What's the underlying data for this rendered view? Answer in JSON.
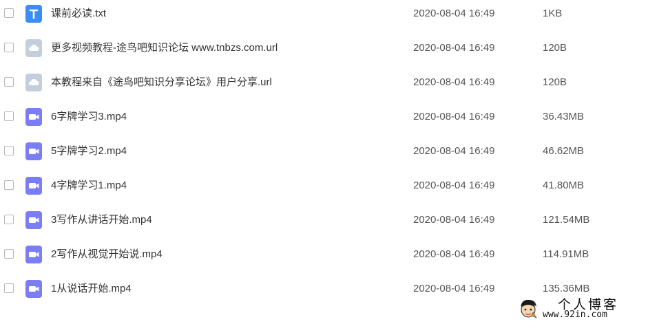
{
  "colors": {
    "txt_icon": "#3b8cf5",
    "cloud_icon": "#c3cfdc",
    "video_icon": "#7b7df5"
  },
  "files": [
    {
      "name": "课前必读.txt",
      "date": "2020-08-04 16:49",
      "size": "1KB",
      "icon": "text-file-icon"
    },
    {
      "name": "更多视频教程-途鸟吧知识论坛 www.tnbzs.com.url",
      "date": "2020-08-04 16:49",
      "size": "120B",
      "icon": "cloud-link-icon"
    },
    {
      "name": "本教程来自《途鸟吧知识分享论坛》用户分享.url",
      "date": "2020-08-04 16:49",
      "size": "120B",
      "icon": "cloud-link-icon"
    },
    {
      "name": "6字牌学习3.mp4",
      "date": "2020-08-04 16:49",
      "size": "36.43MB",
      "icon": "video-file-icon"
    },
    {
      "name": "5字牌学习2.mp4",
      "date": "2020-08-04 16:49",
      "size": "46.62MB",
      "icon": "video-file-icon"
    },
    {
      "name": "4字牌学习1.mp4",
      "date": "2020-08-04 16:49",
      "size": "41.80MB",
      "icon": "video-file-icon"
    },
    {
      "name": "3写作从讲话开始.mp4",
      "date": "2020-08-04 16:49",
      "size": "121.54MB",
      "icon": "video-file-icon"
    },
    {
      "name": "2写作从视觉开始说.mp4",
      "date": "2020-08-04 16:49",
      "size": "114.91MB",
      "icon": "video-file-icon"
    },
    {
      "name": "1从说话开始.mp4",
      "date": "2020-08-04 16:49",
      "size": "135.36MB",
      "icon": "video-file-icon"
    }
  ],
  "watermark": {
    "title": "个人博客",
    "url": "www.92in.com"
  }
}
